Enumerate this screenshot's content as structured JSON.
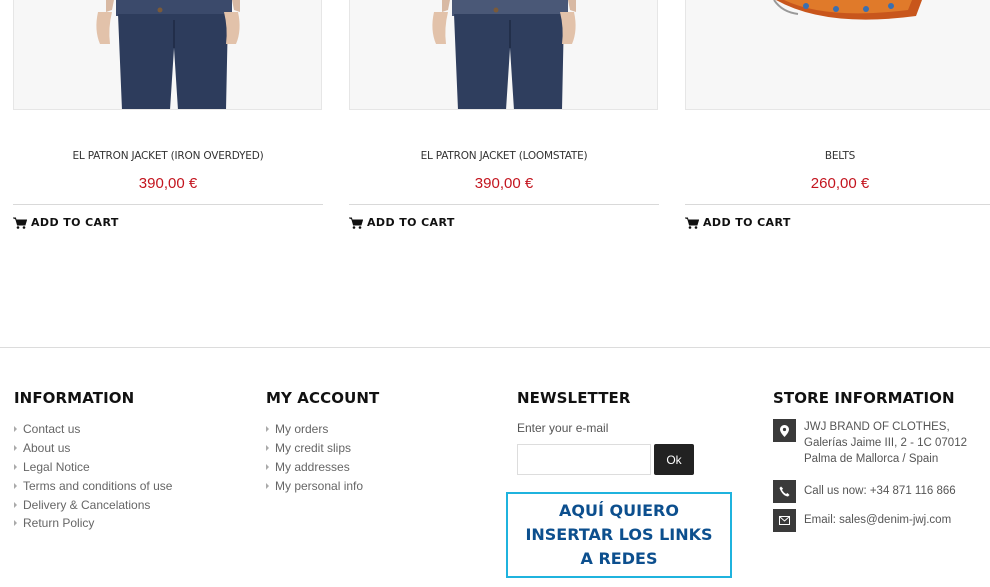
{
  "products": [
    {
      "name": "EL PATRON JACKET (IRON OVERDYED)",
      "price": "390,00 €",
      "cart_label": "ADD TO CART",
      "image": "jeans-man-icon"
    },
    {
      "name": "EL PATRON JACKET (LOOMSTATE)",
      "price": "390,00 €",
      "cart_label": "ADD TO CART",
      "image": "jeans-man-icon"
    },
    {
      "name": "BELTS",
      "price": "260,00 €",
      "cart_label": "ADD TO CART",
      "image": "belt-icon"
    }
  ],
  "footer": {
    "information": {
      "title": "INFORMATION",
      "links": [
        "Contact us",
        "About us",
        "Legal Notice",
        "Terms and conditions of use",
        "Delivery & Cancelations",
        "Return Policy"
      ]
    },
    "account": {
      "title": "MY ACCOUNT",
      "links": [
        "My orders",
        "My credit slips",
        "My addresses",
        "My personal info"
      ]
    },
    "newsletter": {
      "title": "NEWSLETTER",
      "label": "Enter your e-mail",
      "input_value": "",
      "button": "Ok",
      "note": "AQUÍ QUIERO INSERTAR LOS LINKS A REDES"
    },
    "store": {
      "title": "STORE INFORMATION",
      "address": "JWJ BRAND OF CLOTHES,\nGalerías Jaime III, 2 - 1C 07012\nPalma de Mallorca / Spain",
      "phone": "Call us now: +34 871 116 866",
      "email": "Email: sales@denim-jwj.com"
    }
  },
  "colors": {
    "price": "#c3141e",
    "note_border": "#1fb3de",
    "note_text": "#0c4f8e",
    "icon_bg": "#3a3a3a"
  }
}
